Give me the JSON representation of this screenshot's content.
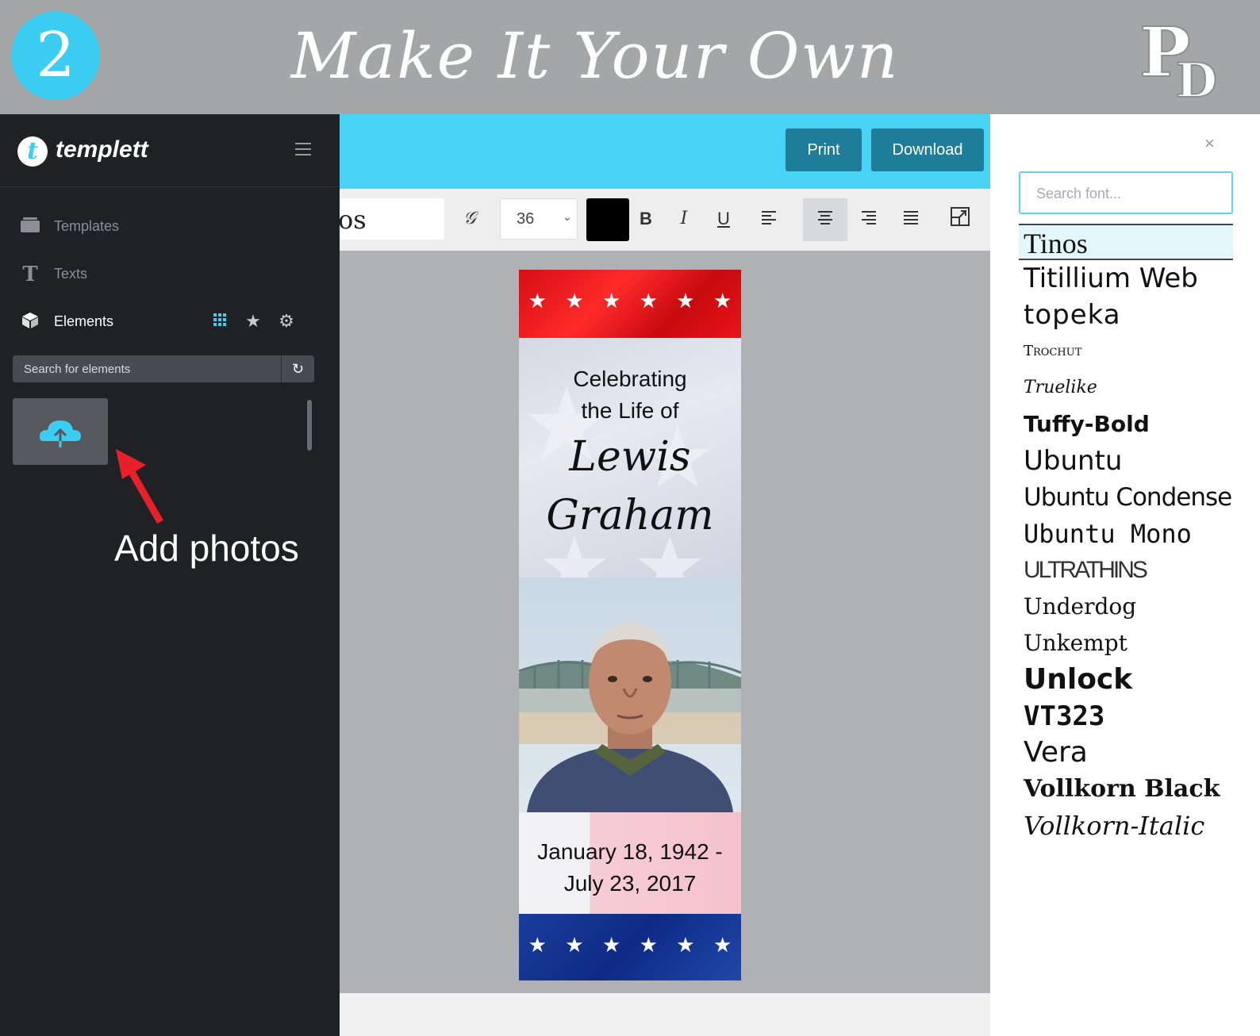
{
  "banner": {
    "step_number": "2",
    "title": "Make It Your Own",
    "brand_mark": "PD"
  },
  "sidebar": {
    "logo_letter": "t",
    "logo_text": "templett",
    "nav": [
      {
        "label": "Templates",
        "icon": "folder-icon"
      },
      {
        "label": "Texts",
        "icon": "text-icon"
      },
      {
        "label": "Elements",
        "icon": "cube-icon",
        "active": true
      }
    ],
    "element_tools": [
      "grid-icon",
      "star-icon",
      "gear-icon"
    ],
    "search_label": "Search for elements",
    "upload_icon": "cloud-upload-icon",
    "annotation": "Add photos"
  },
  "topbar": {
    "print_label": "Print",
    "download_label": "Download"
  },
  "toolbar": {
    "font_preview": "os",
    "font_size": "36",
    "text_color": "#000000",
    "bold": "B",
    "italic": "I",
    "underline": "U"
  },
  "bookmark": {
    "line1": "Celebrating",
    "line2": "the Life of",
    "first_name": "Lewis",
    "last_name": "Graham",
    "date_start": "January 18, 1942 -",
    "date_end": "July 23, 2017",
    "star_glyph": "★"
  },
  "font_panel": {
    "search_placeholder": "Search font...",
    "close_label": "×",
    "fonts": [
      "Tinos",
      "Titillium Web",
      "topeka",
      "Trochut",
      "Truelike",
      "Tuffy-Bold",
      "Ubuntu",
      "Ubuntu Condensed",
      "Ubuntu Mono",
      "ULTRATHINS",
      "Underdog",
      "Unkempt",
      "Unlock",
      "VT323",
      "Vera",
      "Vollkorn Black",
      "Vollkorn-Italic"
    ],
    "selected": "Tinos"
  },
  "colors": {
    "accent": "#47d2f6",
    "button": "#1e7d98",
    "sidebar_bg": "#202125",
    "banner_bg": "#a5a6a8"
  }
}
